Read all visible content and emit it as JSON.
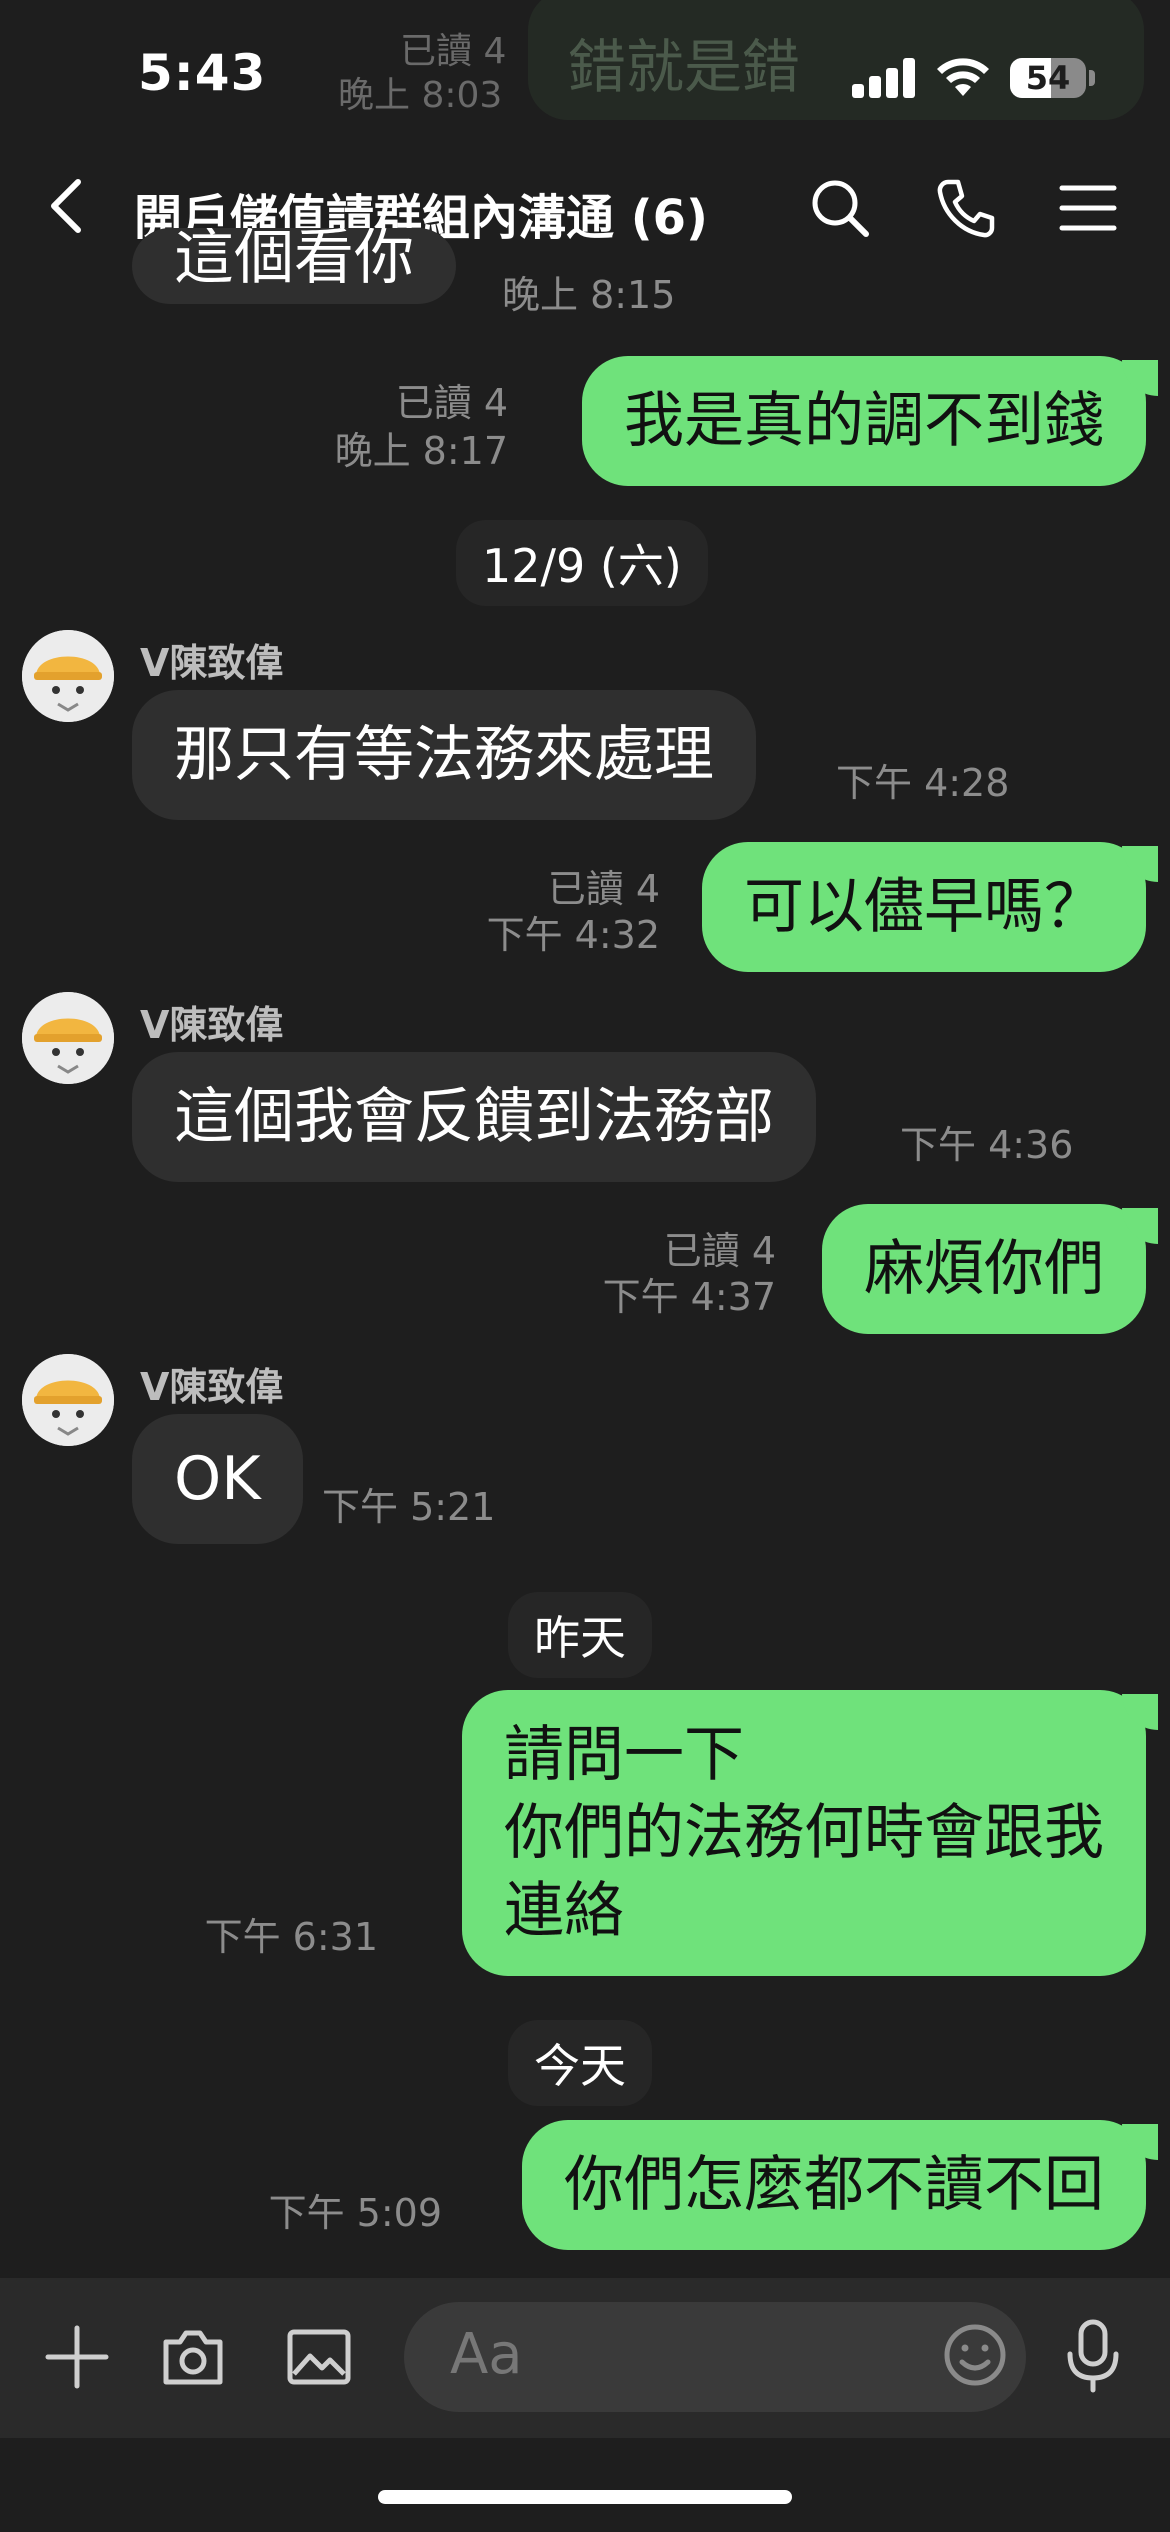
{
  "status_bar": {
    "time": "5:43",
    "battery": "54"
  },
  "background_fragment": {
    "read": "已讀 4",
    "time": "晚上 8:03",
    "text": "錯就是錯"
  },
  "header": {
    "title": "開戶儲值請群組內溝通 (6)"
  },
  "messages": [
    {
      "type": "in",
      "text": "這個看你",
      "time": "晚上 8:15"
    },
    {
      "type": "out",
      "read": "已讀 4",
      "time": "晚上 8:17",
      "text": "我是真的調不到錢"
    },
    {
      "type": "date",
      "text": "12/9 (六)"
    },
    {
      "type": "in",
      "sender": "V陳致偉",
      "text": "那只有等法務來處理",
      "time": "下午 4:28"
    },
    {
      "type": "out",
      "read": "已讀 4",
      "time": "下午 4:32",
      "text": "可以儘早嗎？"
    },
    {
      "type": "in",
      "sender": "V陳致偉",
      "text": "這個我會反饋到法務部",
      "time": "下午 4:36"
    },
    {
      "type": "out",
      "read": "已讀 4",
      "time": "下午 4:37",
      "text": "麻煩你們"
    },
    {
      "type": "in",
      "sender": "V陳致偉",
      "text": "OK",
      "time": "下午 5:21"
    },
    {
      "type": "date",
      "text": "昨天"
    },
    {
      "type": "out",
      "time": "下午 6:31",
      "lines": [
        "請問一下",
        "你們的法務何時會跟我",
        "連絡"
      ]
    },
    {
      "type": "date",
      "text": "今天"
    },
    {
      "type": "out",
      "time": "下午 5:09",
      "text": "你們怎麼都不讀不回"
    }
  ],
  "input": {
    "placeholder": "Aa"
  },
  "colors": {
    "background": "#1e1e1e",
    "outgoing": "#6fe27b",
    "incoming": "#2f2f2f"
  }
}
